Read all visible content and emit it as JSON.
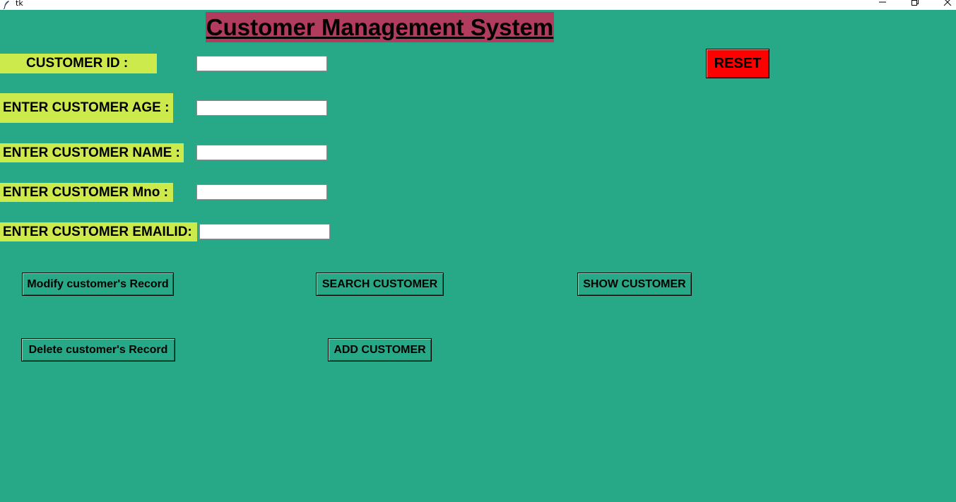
{
  "window": {
    "title": "tk"
  },
  "header": {
    "title": "Customer Management System"
  },
  "form": {
    "fields": [
      {
        "label": "CUSTOMER ID :",
        "value": ""
      },
      {
        "label": "ENTER CUSTOMER AGE :",
        "value": ""
      },
      {
        "label": "ENTER CUSTOMER NAME :",
        "value": ""
      },
      {
        "label": "ENTER CUSTOMER Mno :",
        "value": ""
      },
      {
        "label": "ENTER CUSTOMER EMAILID:",
        "value": ""
      }
    ]
  },
  "buttons": {
    "reset": "RESET",
    "modify": "Modify customer's Record",
    "search": "SEARCH CUSTOMER",
    "show": "SHOW CUSTOMER",
    "delete": "Delete customer's Record",
    "add": "ADD CUSTOMER"
  },
  "colors": {
    "background": "#27a886",
    "title_bg": "#b13c5e",
    "label_bg": "#ccea4c",
    "reset_bg": "#ff0000"
  },
  "icons": {
    "app": "feather-icon",
    "minimize": "minimize-icon",
    "maximize": "restore-icon",
    "close": "close-icon"
  }
}
